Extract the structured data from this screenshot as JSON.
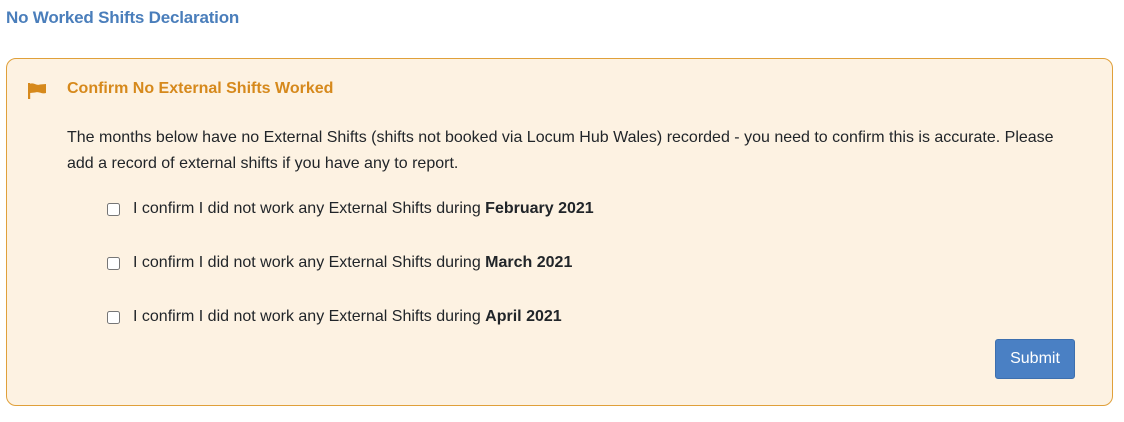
{
  "page": {
    "title": "No Worked Shifts Declaration"
  },
  "panel": {
    "icon": "flag-icon",
    "title": "Confirm No External Shifts Worked",
    "description": "The months below have no External Shifts (shifts not booked via Locum Hub Wales) recorded - you need to confirm this is accurate. Please add a record of external shifts if you have any to report.",
    "confirmations": [
      {
        "text": "I confirm I did not work any External Shifts during ",
        "month": "February 2021",
        "checked": false
      },
      {
        "text": "I confirm I did not work any External Shifts during ",
        "month": "March 2021",
        "checked": false
      },
      {
        "text": "I confirm I did not work any External Shifts during ",
        "month": "April 2021",
        "checked": false
      }
    ],
    "submit_label": "Submit"
  },
  "colors": {
    "title": "#4a7ebb",
    "panel_background": "#fdf2e2",
    "panel_border": "#e0a03a",
    "accent_orange": "#d6891c",
    "button": "#4a80c4"
  }
}
